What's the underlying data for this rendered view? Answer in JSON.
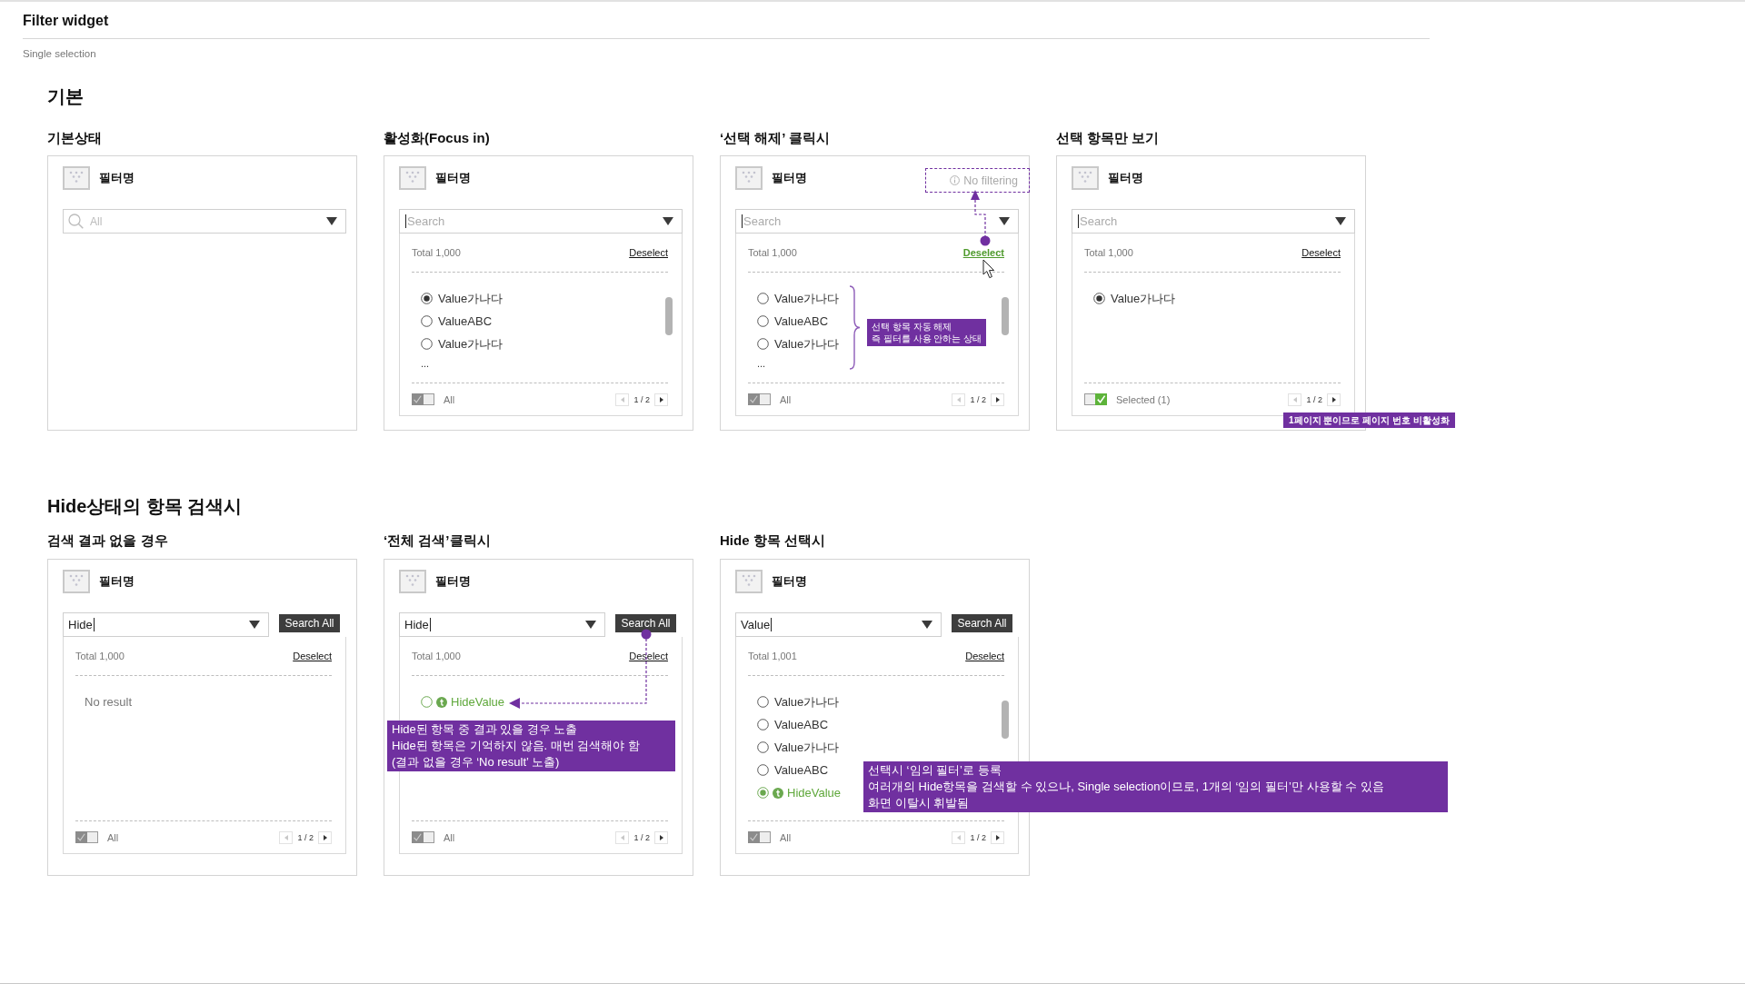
{
  "page": {
    "title": "Filter widget",
    "subtitle": "Single selection"
  },
  "sections": [
    {
      "title": "기본",
      "examples": [
        {
          "title": "기본상태",
          "widget": {
            "name": "필터명",
            "search": {
              "placeholder": "All",
              "focused": false
            }
          }
        },
        {
          "title": "활성화(Focus in)",
          "widget": {
            "name": "필터명",
            "search": {
              "placeholder": "Search",
              "focused": true
            },
            "panel": {
              "total": "Total 1,000",
              "deselect": {
                "label": "Deselect",
                "pressed": false
              },
              "items": [
                {
                  "label": "Value가나다",
                  "selected": true,
                  "hidden": false
                },
                {
                  "label": "ValueABC",
                  "selected": false,
                  "hidden": false
                },
                {
                  "label": "Value가나다",
                  "selected": false,
                  "hidden": false
                }
              ],
              "more": "...",
              "scrollable": true,
              "footer": {
                "toggle_label": "All",
                "on": false,
                "page": "1 / 2"
              }
            }
          }
        },
        {
          "title": "‘선택 해제’ 클릭시",
          "widget": {
            "name": "필터명",
            "status_tag": "No filtering",
            "search": {
              "placeholder": "Search",
              "focused": true
            },
            "panel": {
              "total": "Total 1,000",
              "deselect": {
                "label": "Deselect",
                "pressed": true
              },
              "items": [
                {
                  "label": "Value가나다",
                  "selected": false,
                  "hidden": false
                },
                {
                  "label": "ValueABC",
                  "selected": false,
                  "hidden": false
                },
                {
                  "label": "Value가나다",
                  "selected": false,
                  "hidden": false
                }
              ],
              "more": "...",
              "scrollable": true,
              "footer": {
                "toggle_label": "All",
                "on": false,
                "page": "1 / 2"
              }
            }
          },
          "notes": [
            {
              "kind": "tag-arrow"
            },
            {
              "kind": "brace",
              "lines": [
                "선택 항목 자동 해제",
                "즉 필터를 사용 안하는 상태"
              ]
            }
          ]
        },
        {
          "title": "선택 항목만 보기",
          "widget": {
            "name": "필터명",
            "search": {
              "placeholder": "Search",
              "focused": true
            },
            "panel": {
              "total": "Total 1,000",
              "deselect": {
                "label": "Deselect",
                "pressed": false
              },
              "items": [
                {
                  "label": "Value가나다",
                  "selected": true,
                  "hidden": false
                }
              ],
              "scrollable": false,
              "footer": {
                "toggle_label": "Selected (1)",
                "on": true,
                "page": "1 / 2"
              }
            }
          },
          "notes": [
            {
              "kind": "page-label",
              "lines": [
                "1페이지 뿐이므로 페이지 번호 비활성화"
              ]
            }
          ]
        }
      ]
    },
    {
      "title": "Hide상태의 항목 검색시",
      "examples": [
        {
          "title": "검색 결과 없을 경우",
          "widget": {
            "name": "필터명",
            "search": {
              "value": "Hide",
              "focused": true
            },
            "search_all": "Search All",
            "panel": {
              "total": "Total 1,000",
              "deselect": {
                "label": "Deselect",
                "pressed": false
              },
              "empty_text": "No result",
              "scrollable": false,
              "footer": {
                "toggle_label": "All",
                "on": false,
                "page": "1 / 2"
              }
            }
          }
        },
        {
          "title": "‘전체 검색’클릭시",
          "widget": {
            "name": "필터명",
            "search": {
              "value": "Hide",
              "focused": true
            },
            "search_all": "Search All",
            "panel": {
              "total": "Total 1,000",
              "deselect": {
                "label": "Deselect",
                "pressed": false
              },
              "items": [
                {
                  "label": "HideValue",
                  "selected": false,
                  "hidden": true
                }
              ],
              "scrollable": false,
              "footer": {
                "toggle_label": "All",
                "on": false,
                "page": "1 / 2"
              }
            }
          },
          "notes": [
            {
              "kind": "result-arrow"
            },
            {
              "kind": "result-label",
              "lines": [
                "Hide된 항목 중 결과 있을 경우 노출",
                "Hide된 항목은 기억하지 않음. 매번 검색해야 함",
                "(결과 없을 경우 ‘No result’ 노출)"
              ]
            }
          ]
        },
        {
          "title": "Hide 항목 선택시",
          "widget": {
            "name": "필터명",
            "search": {
              "value": "Value",
              "focused": true
            },
            "search_all": "Search All",
            "panel": {
              "total": "Total 1,001",
              "deselect": {
                "label": "Deselect",
                "pressed": false
              },
              "items": [
                {
                  "label": "Value가나다",
                  "selected": false,
                  "hidden": false
                },
                {
                  "label": "ValueABC",
                  "selected": false,
                  "hidden": false
                },
                {
                  "label": "Value가나다",
                  "selected": false,
                  "hidden": false
                },
                {
                  "label": "ValueABC",
                  "selected": false,
                  "hidden": false
                },
                {
                  "label": "HideValue",
                  "selected": true,
                  "hidden": true
                }
              ],
              "scrollable": true,
              "footer": {
                "toggle_label": "All",
                "on": false,
                "page": "1 / 2"
              }
            }
          },
          "notes": [
            {
              "kind": "select-label",
              "lines": [
                "선택시 ‘임의 필터’로 등록",
                "여러개의 Hide항목을 검색할 수 있으나, Single selection이므로, 1개의 ‘임의 필터’만 사용할 수 있음",
                "화면 이탈시 휘발됨"
              ]
            }
          ]
        }
      ]
    }
  ]
}
